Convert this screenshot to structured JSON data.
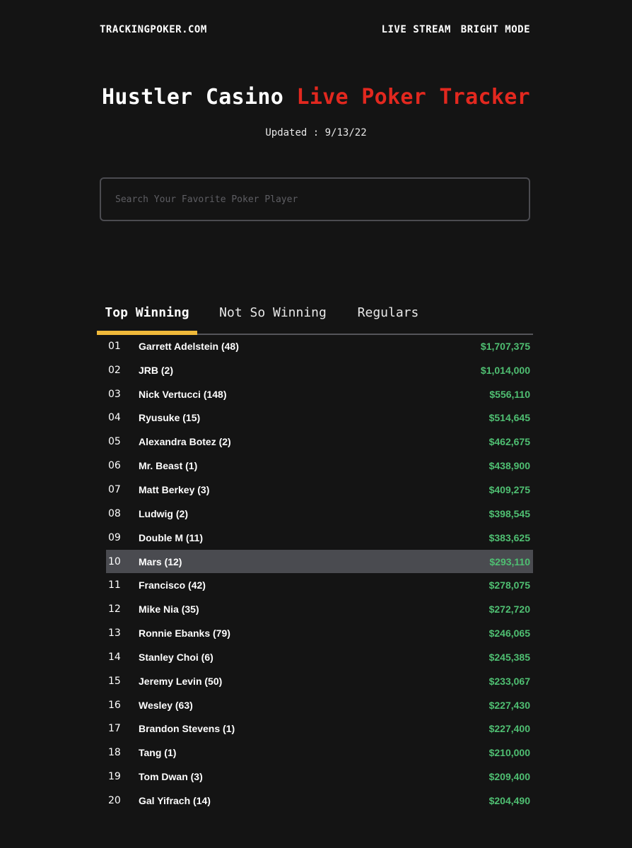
{
  "nav": {
    "brand": "TRACKINGPOKER.COM",
    "live_stream": "LIVE STREAM",
    "bright_mode": "BRIGHT MODE"
  },
  "header": {
    "title_main": "Hustler Casino",
    "title_accent": "Live Poker Tracker",
    "updated": "Updated : 9/13/22"
  },
  "search": {
    "placeholder": "Search Your Favorite Poker Player",
    "value": ""
  },
  "tabs": [
    {
      "label": "Top Winning",
      "active": true
    },
    {
      "label": "Not So Winning",
      "active": false
    },
    {
      "label": "Regulars",
      "active": false
    }
  ],
  "colors": {
    "accent_red": "#e2281f",
    "tab_indicator": "#f0b93a",
    "amount_green": "#4fbf72",
    "highlight_row": "#4a4b50"
  },
  "leaderboard": [
    {
      "rank": "01",
      "name": "Garrett Adelstein (48)",
      "amount": "$1,707,375"
    },
    {
      "rank": "02",
      "name": "JRB (2)",
      "amount": "$1,014,000"
    },
    {
      "rank": "03",
      "name": "Nick Vertucci (148)",
      "amount": "$556,110"
    },
    {
      "rank": "04",
      "name": "Ryusuke (15)",
      "amount": "$514,645"
    },
    {
      "rank": "05",
      "name": "Alexandra Botez (2)",
      "amount": "$462,675"
    },
    {
      "rank": "06",
      "name": "Mr. Beast (1)",
      "amount": "$438,900"
    },
    {
      "rank": "07",
      "name": "Matt Berkey (3)",
      "amount": "$409,275"
    },
    {
      "rank": "08",
      "name": "Ludwig (2)",
      "amount": "$398,545"
    },
    {
      "rank": "09",
      "name": "Double M (11)",
      "amount": "$383,625"
    },
    {
      "rank": "10",
      "name": "Mars (12)",
      "amount": "$293,110",
      "highlighted": true
    },
    {
      "rank": "11",
      "name": "Francisco (42)",
      "amount": "$278,075"
    },
    {
      "rank": "12",
      "name": "Mike Nia (35)",
      "amount": "$272,720"
    },
    {
      "rank": "13",
      "name": "Ronnie Ebanks (79)",
      "amount": "$246,065"
    },
    {
      "rank": "14",
      "name": "Stanley Choi (6)",
      "amount": "$245,385"
    },
    {
      "rank": "15",
      "name": "Jeremy Levin (50)",
      "amount": "$233,067"
    },
    {
      "rank": "16",
      "name": "Wesley (63)",
      "amount": "$227,430"
    },
    {
      "rank": "17",
      "name": "Brandon Stevens (1)",
      "amount": "$227,400"
    },
    {
      "rank": "18",
      "name": "Tang (1)",
      "amount": "$210,000"
    },
    {
      "rank": "19",
      "name": "Tom Dwan (3)",
      "amount": "$209,400"
    },
    {
      "rank": "20",
      "name": "Gal Yifrach (14)",
      "amount": "$204,490"
    }
  ]
}
